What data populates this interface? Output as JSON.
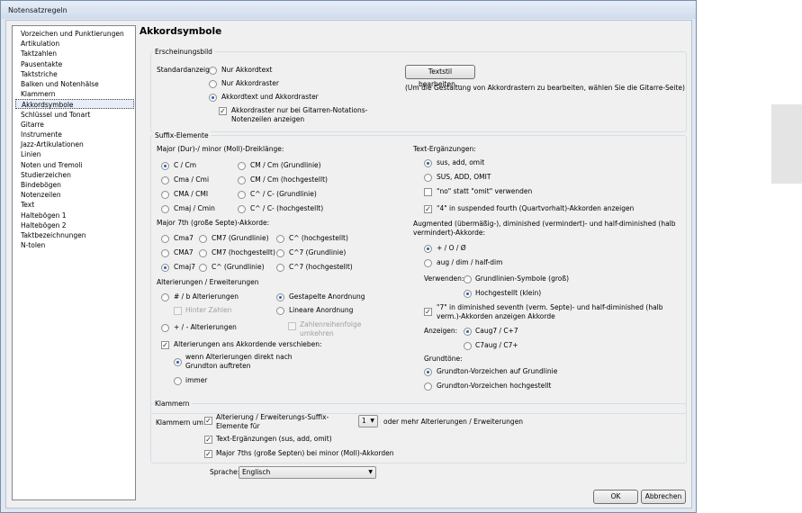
{
  "window": {
    "title": "Notensatzregeln"
  },
  "page_title": "Akkordsymbole",
  "categories": [
    "Vorzeichen und Punktierungen",
    "Artikulation",
    "Taktzahlen",
    "Pausentakte",
    "Taktstriche",
    "Balken und Notenhälse",
    "Klammern",
    "Akkordsymbole",
    "Schlüssel und Tonart",
    "Gitarre",
    "Instrumente",
    "Jazz-Artikulationen",
    "Linien",
    "Noten und Tremoli",
    "Studierzeichen",
    "Bindebögen",
    "Notenzeilen",
    "Text",
    "Haltebögen 1",
    "Haltebögen 2",
    "Taktbezeichnungen",
    "N-tolen"
  ],
  "selected_category": "Akkordsymbole",
  "erscheinungsbild": {
    "legend": "Erscheinungsbild",
    "standard_label": "Standardanzeige:",
    "options": [
      "Nur Akkordtext",
      "Nur Akkordraster",
      "Akkordtext und Akkordraster"
    ],
    "selected": "Akkordtext und Akkordraster",
    "only_tab_checkbox": "Akkordraster nur bei Gitarren-Notations-Notenzeilen anzeigen",
    "textstil_button": "Textstil bearbeiten...",
    "hint": "(Um die Gestaltung von Akkordrastern zu bearbeiten, wählen Sie die Gitarre-Seite)"
  },
  "suffix": {
    "legend": "Suffix-Elemente",
    "triad_heading": "Major (Dur)-/ minor (Moll)-Dreiklänge:",
    "triad_col1": [
      "C / Cm",
      "Cma / Cmi",
      "CMA / CMI",
      "Cmaj / Cmin"
    ],
    "triad_col2": [
      "CM / Cm (Grundlinie)",
      "CM / Cm (hochgestellt)",
      "C^ / C- (Grundlinie)",
      "C^ / C- (hochgestellt)"
    ],
    "triad_selected": "C / Cm",
    "seventh_heading": "Major 7th (große Septe)-Akkorde:",
    "seventh_col1": [
      "Cma7",
      "CMA7",
      "Cmaj7"
    ],
    "seventh_col2": [
      "CM7 (Grundlinie)",
      "CM7 (hochgestellt)",
      "C^ (Grundlinie)"
    ],
    "seventh_col3": [
      "C^ (hochgestellt)",
      "C^7 (Grundlinie)",
      "C^7 (hochgestellt)"
    ],
    "seventh_selected": "Cmaj7",
    "alt_heading": "Alterierungen / Erweiterungen",
    "alt_sharp": "# / b Alterierungen",
    "alt_hinter": "Hinter Zahlen",
    "alt_plus": "+ / - Alterierungen",
    "alt_stacked": "Gestapelte Anordnung",
    "alt_linear": "Lineare Anordnung",
    "alt_zahlen": "Zahlenreihenfolge umkehren",
    "alt_move": "Alterierungen ans Akkordende verschieben:",
    "alt_move_opt1": "wenn Alterierungen direkt nach Grundton auftreten",
    "alt_move_opt2": "immer",
    "text_heading": "Text-Ergänzungen:",
    "text_opts": [
      "sus, add, omit",
      "SUS, ADD, OMIT"
    ],
    "text_selected": "sus, add, omit",
    "no_check": "\"no\" statt \"omit\" verwenden",
    "sus4_check": "\"4\" in suspended fourth (Quartvorhalt)-Akkorden anzeigen",
    "aug_heading": "Augmented (übermäßig-), diminished (vermindert)- und half-diminished (halb vermindert)-Akkorde:",
    "aug_opts": [
      "+ / O / Ø",
      "aug / dim / half-dim"
    ],
    "aug_selected": "+ / O / Ø",
    "verwenden_label": "Verwenden:",
    "verwenden_opts": [
      "Grundlinien-Symbole (groß)",
      "Hochgestellt (klein)"
    ],
    "verwenden_selected": "Hochgestellt (klein)",
    "seven_check": "\"7\" in diminished seventh (verm. Septe)- und half-diminished (halb verm.)-Akkorden anzeigen Akkorde",
    "anzeigen_label": "Anzeigen:",
    "anzeigen_opts": [
      "Caug7 / C+7",
      "C7aug / C7+"
    ],
    "anzeigen_selected": "Caug7 / C+7",
    "grundtoene_heading": "Grundtöne:",
    "grundtoene_opts": [
      "Grundton-Vorzeichen auf Grundlinie",
      "Grundton-Vorzeichen hochgestellt"
    ],
    "grundtoene_selected": "Grundton-Vorzeichen auf Grundlinie"
  },
  "klammern": {
    "legend": "Klammern",
    "label": "Klammern um:",
    "check1": "Alterierung / Erweiterungs-Suffix-Elemente für",
    "count_value": "1",
    "check1_suffix": "oder mehr Alterierungen / Erweiterungen",
    "check2": "Text-Ergänzungen (sus, add, omit)",
    "check3": "Major 7ths (große Septen) bei minor (Moll)-Akkorden"
  },
  "sprache": {
    "label": "Sprache:",
    "value": "Englisch"
  },
  "buttons": {
    "ok": "OK",
    "cancel": "Abbrechen"
  }
}
